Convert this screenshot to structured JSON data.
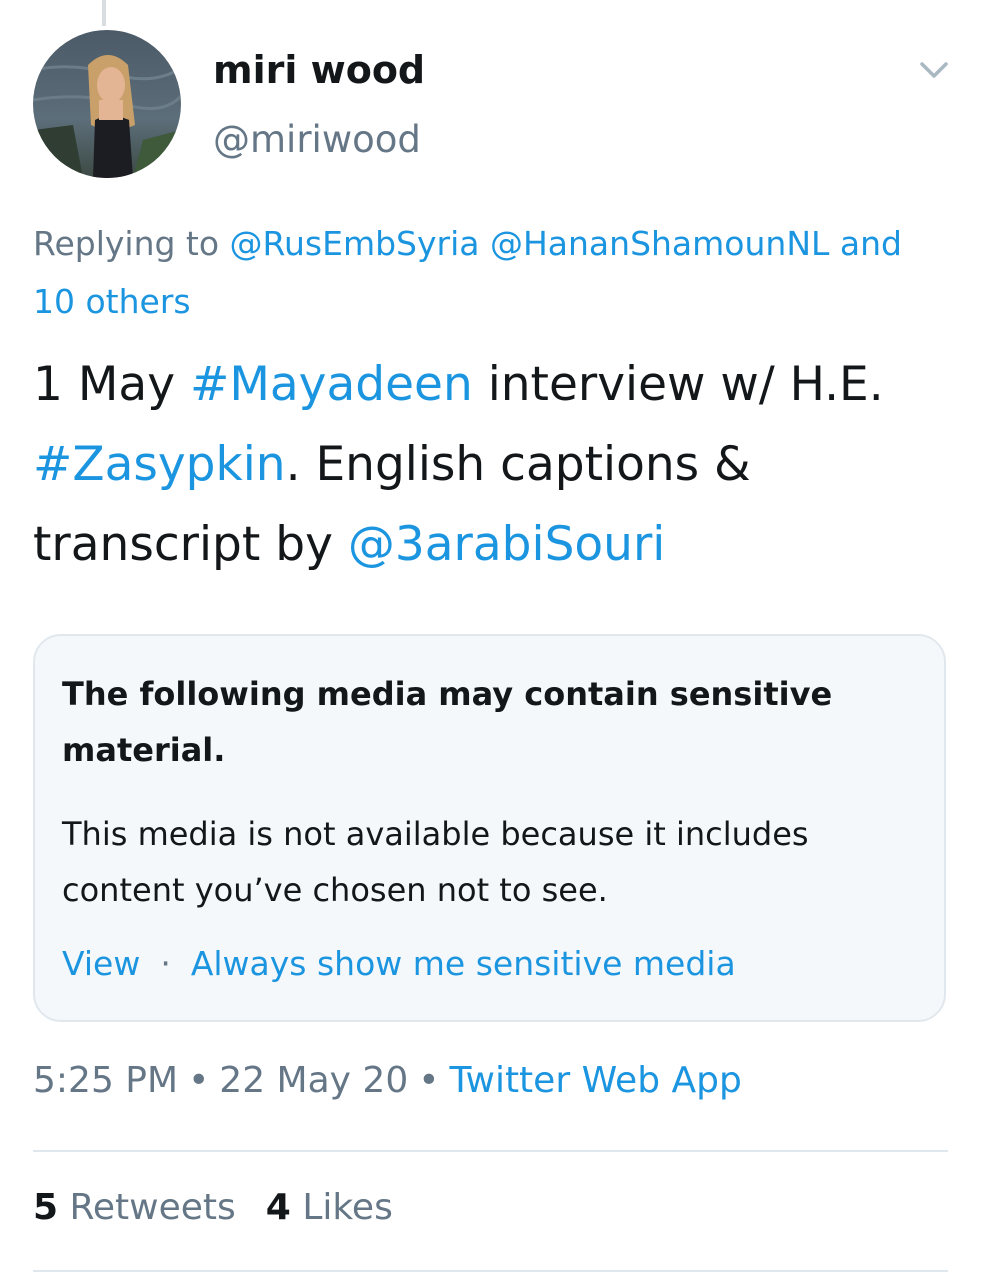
{
  "tweet": {
    "author": {
      "display_name": "miri wood",
      "handle": "@miriwood"
    },
    "reply": {
      "prefix": "Replying to",
      "mention_1": "@RusEmbSyria",
      "mention_2": "@HananShamounNL",
      "others": "and 10 others"
    },
    "text": {
      "part_1": "1 May ",
      "hashtag_1": "#Mayadeen",
      "part_2": " interview w/ H.E. ",
      "hashtag_2": "#Zasypkin",
      "part_3": ". English captions & transcript by ",
      "mention": "@3arabiSouri"
    },
    "sensitive_media": {
      "title": "The following media may contain sensitive material.",
      "body": "This media is not available because it includes content you’ve chosen not to see.",
      "view_label": "View",
      "separator": "·",
      "always_show_label": "Always show me sensitive media"
    },
    "meta": {
      "time": "5:25 PM",
      "date": "22 May 20",
      "separator": "•",
      "source": "Twitter Web App"
    },
    "stats": {
      "retweets_count": "5",
      "retweets_label": "Retweets",
      "likes_count": "4",
      "likes_label": "Likes"
    }
  },
  "icons": {
    "menu": "chevron-down-icon"
  },
  "colors": {
    "link": "#1b95e0",
    "secondary_text": "#657786",
    "primary_text": "#14171a",
    "card_background": "#f5f8fa",
    "border": "#e1e8ed"
  }
}
